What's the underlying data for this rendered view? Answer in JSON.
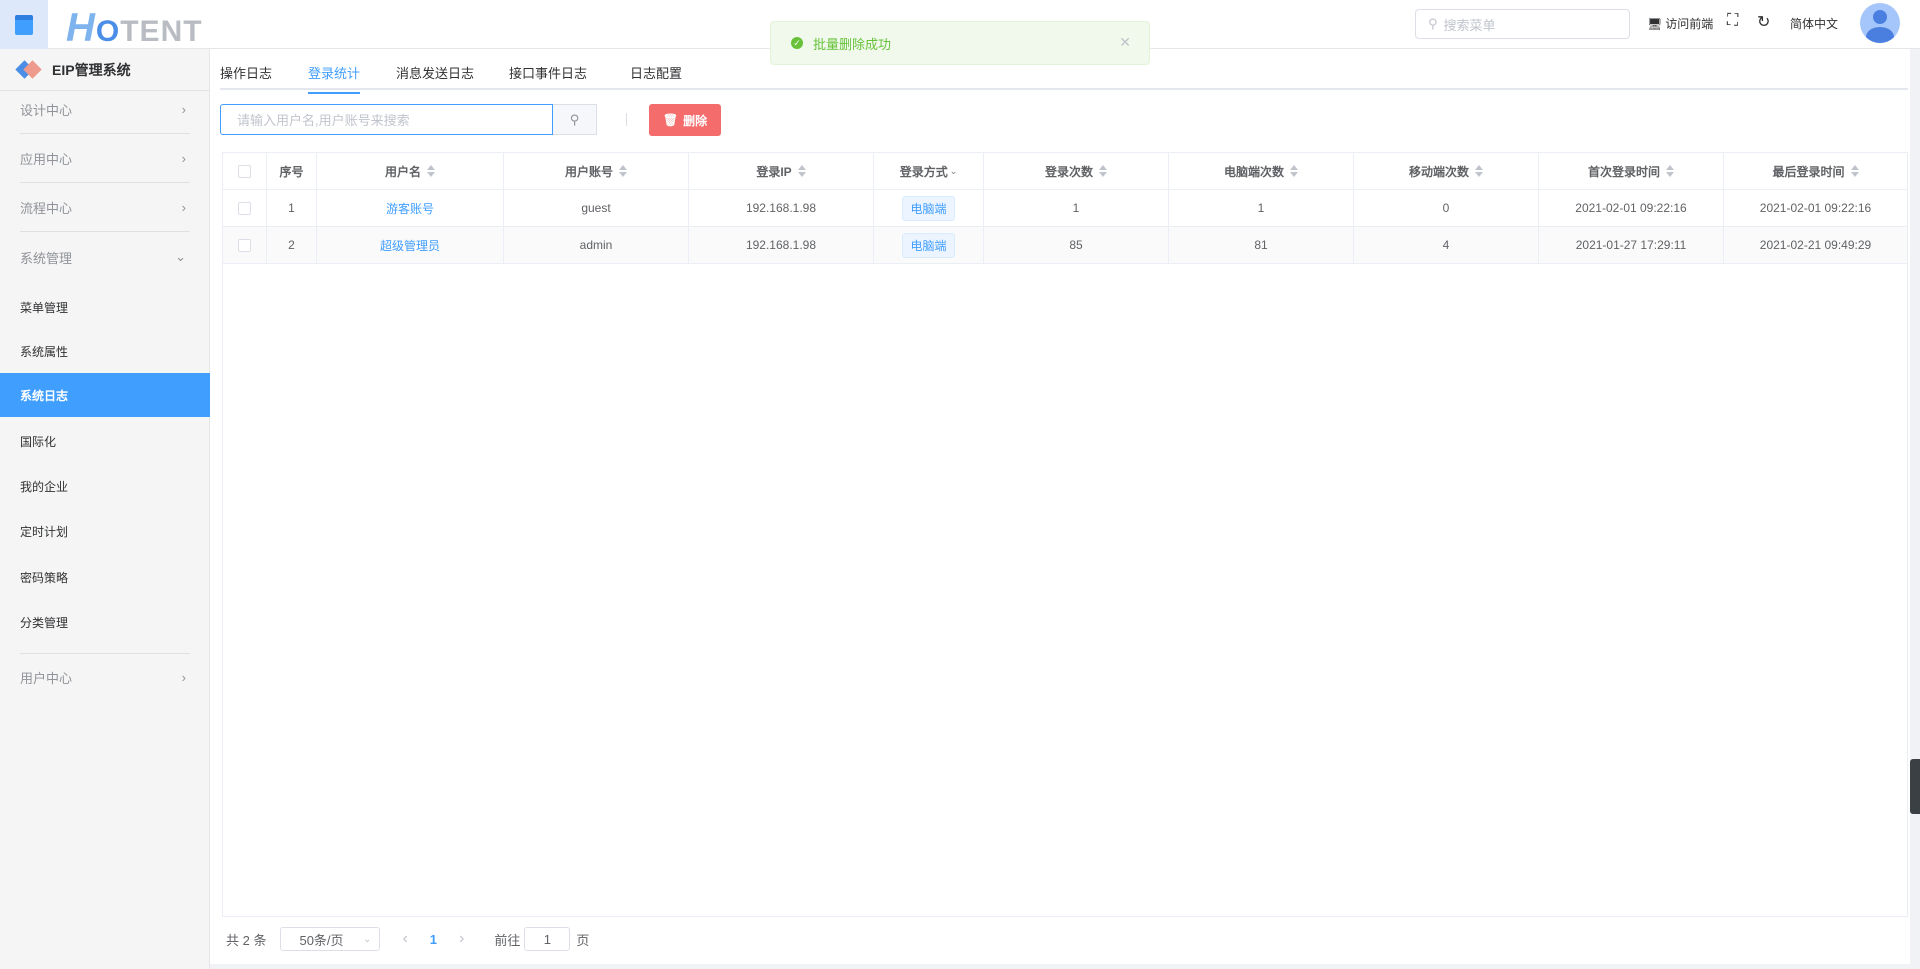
{
  "header": {
    "logo": "HOTENT",
    "search_placeholder": "搜索菜单",
    "visit_frontend": "访问前端",
    "language": "简体中文"
  },
  "sidebar": {
    "system_title": "EIP管理系统",
    "groups": [
      "设计中心",
      "应用中心",
      "流程中心",
      "系统管理",
      "用户中心"
    ],
    "sub_items": [
      "菜单管理",
      "系统属性",
      "系统日志",
      "国际化",
      "我的企业",
      "定时计划",
      "密码策略",
      "分类管理"
    ],
    "active": "系统日志"
  },
  "tabs": [
    "操作日志",
    "登录统计",
    "消息发送日志",
    "接口事件日志",
    "日志配置"
  ],
  "active_tab": "登录统计",
  "toolbar": {
    "search_placeholder": "请输入用户名,用户账号来搜索",
    "delete_label": "删除"
  },
  "table": {
    "headers": [
      "序号",
      "用户名",
      "用户账号",
      "登录IP",
      "登录方式",
      "登录次数",
      "电脑端次数",
      "移动端次数",
      "首次登录时间",
      "最后登录时间"
    ],
    "rows": [
      [
        "1",
        "游客账号",
        "guest",
        "192.168.1.98",
        "电脑端",
        "1",
        "1",
        "0",
        "2021-02-01 09:22:16",
        "2021-02-01 09:22:16"
      ],
      [
        "2",
        "超级管理员",
        "admin",
        "192.168.1.98",
        "电脑端",
        "85",
        "81",
        "4",
        "2021-01-27 17:29:11",
        "2021-02-21 09:49:29"
      ]
    ]
  },
  "pagination": {
    "total": "共 2 条",
    "page_size": "50条/页",
    "current_page": "1",
    "goto_label": "前往",
    "goto_value": "1",
    "page_unit": "页"
  },
  "toast": {
    "message": "批量删除成功"
  },
  "colors": {
    "primary": "#409eff",
    "danger": "#f56c6c",
    "success": "#67c23a"
  }
}
